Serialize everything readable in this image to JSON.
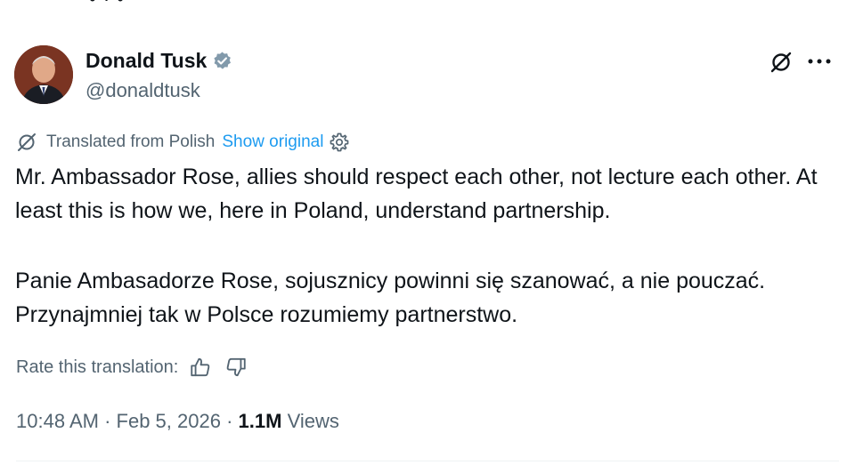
{
  "top_fragment": "• · •",
  "post": {
    "author_name": "Donald Tusk",
    "handle": "@donaldtusk",
    "verified": true,
    "translation_notice": "Translated from Polish",
    "show_original_label": "Show original",
    "paragraph_english": "Mr. Ambassador Rose, allies should respect each other, not lecture each other. At least this is how we, here in Poland, understand partnership.",
    "paragraph_polish": "Panie Ambasadorze Rose, sojusznicy powinni się szanować, a nie pouczać. Przynajmniej tak w Polsce rozumiemy partnerstwo.",
    "rate_translation_label": "Rate this translation:",
    "time": "10:48 AM",
    "separator": " · ",
    "date": "Feb 5, 2026",
    "views_count": "1.1M",
    "views_label": "Views"
  },
  "icons": {
    "verified": "verified-badge-icon",
    "grok": "grok-icon",
    "more": "more-dots-icon",
    "translate": "translate-icon",
    "settings": "gear-icon",
    "thumbs_up": "thumbs-up-icon",
    "thumbs_down": "thumbs-down-icon"
  },
  "colors": {
    "text_primary": "#0f1419",
    "text_secondary": "#536471",
    "link": "#1d9bf0",
    "verified_badge": "#829aab"
  }
}
